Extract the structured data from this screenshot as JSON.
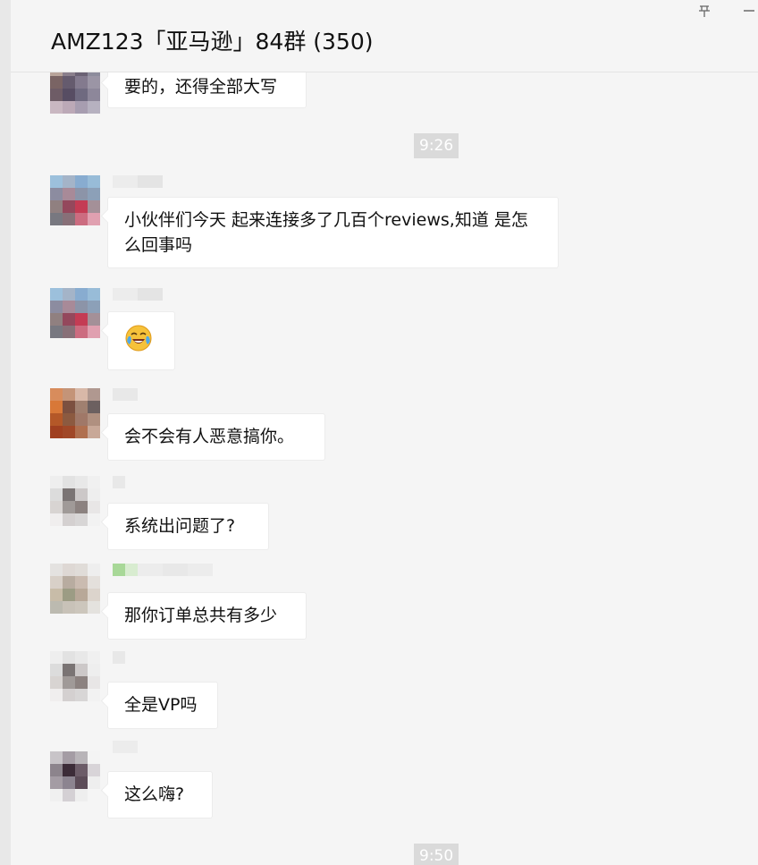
{
  "window": {
    "title": "AMZ123「亚马逊」84群 (350)",
    "pin_glyph": "卆",
    "minimize_glyph": "—"
  },
  "timestamps": [
    "9:26",
    "9:50"
  ],
  "messages": [
    {
      "text": "要的，还得全部大写"
    },
    {
      "text": "小伙伴们今天 起来连接多了几百个reviews,知道 是怎么回事吗"
    },
    {
      "type": "emoji",
      "icon": "crying-laughing-face-icon"
    },
    {
      "text": "会不会有人恶意搞你。"
    },
    {
      "text": "系统出问题了?"
    },
    {
      "text": "那你订单总共有多少"
    },
    {
      "text": "全是VP吗"
    },
    {
      "text": "这么嗨?"
    }
  ]
}
